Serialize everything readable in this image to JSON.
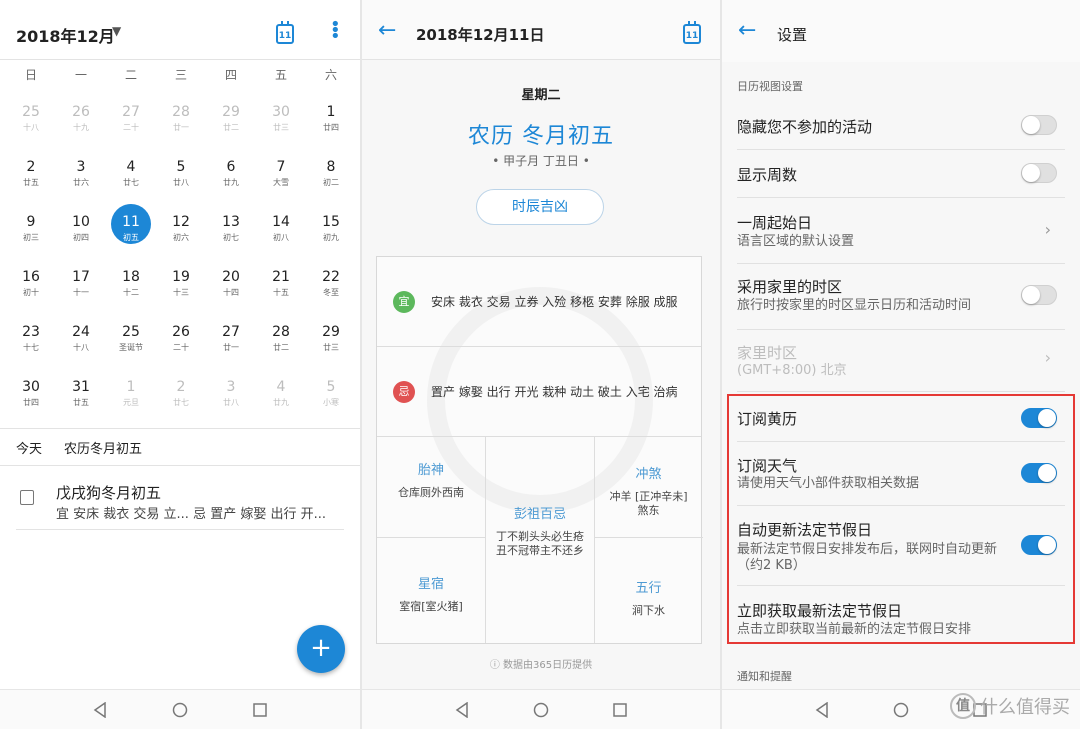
{
  "month_view": {
    "title": "2018年12月",
    "today_icon_num": "11",
    "weekdays": [
      "日",
      "一",
      "二",
      "三",
      "四",
      "五",
      "六"
    ],
    "weeks": [
      [
        {
          "n": "25",
          "l": "十八",
          "dim": true
        },
        {
          "n": "26",
          "l": "十九",
          "dim": true
        },
        {
          "n": "27",
          "l": "二十",
          "dim": true
        },
        {
          "n": "28",
          "l": "廿一",
          "dim": true
        },
        {
          "n": "29",
          "l": "廿二",
          "dim": true
        },
        {
          "n": "30",
          "l": "廿三",
          "dim": true
        },
        {
          "n": "1",
          "l": "廿四"
        }
      ],
      [
        {
          "n": "2",
          "l": "廿五"
        },
        {
          "n": "3",
          "l": "廿六"
        },
        {
          "n": "4",
          "l": "廿七"
        },
        {
          "n": "5",
          "l": "廿八"
        },
        {
          "n": "6",
          "l": "廿九"
        },
        {
          "n": "7",
          "l": "大雪"
        },
        {
          "n": "8",
          "l": "初二"
        }
      ],
      [
        {
          "n": "9",
          "l": "初三"
        },
        {
          "n": "10",
          "l": "初四"
        },
        {
          "n": "11",
          "l": "初五",
          "sel": true
        },
        {
          "n": "12",
          "l": "初六"
        },
        {
          "n": "13",
          "l": "初七"
        },
        {
          "n": "14",
          "l": "初八"
        },
        {
          "n": "15",
          "l": "初九"
        }
      ],
      [
        {
          "n": "16",
          "l": "初十"
        },
        {
          "n": "17",
          "l": "十一"
        },
        {
          "n": "18",
          "l": "十二"
        },
        {
          "n": "19",
          "l": "十三"
        },
        {
          "n": "20",
          "l": "十四"
        },
        {
          "n": "21",
          "l": "十五"
        },
        {
          "n": "22",
          "l": "冬至"
        }
      ],
      [
        {
          "n": "23",
          "l": "十七"
        },
        {
          "n": "24",
          "l": "十八"
        },
        {
          "n": "25",
          "l": "圣诞节"
        },
        {
          "n": "26",
          "l": "二十"
        },
        {
          "n": "27",
          "l": "廿一"
        },
        {
          "n": "28",
          "l": "廿二"
        },
        {
          "n": "29",
          "l": "廿三"
        }
      ],
      [
        {
          "n": "30",
          "l": "廿四"
        },
        {
          "n": "31",
          "l": "廿五"
        },
        {
          "n": "1",
          "l": "元旦",
          "dim": true
        },
        {
          "n": "2",
          "l": "廿七",
          "dim": true
        },
        {
          "n": "3",
          "l": "廿八",
          "dim": true
        },
        {
          "n": "4",
          "l": "廿九",
          "dim": true
        },
        {
          "n": "5",
          "l": "小寒",
          "dim": true
        }
      ]
    ],
    "today_label": "今天",
    "today_lunar": "农历冬月初五",
    "event_title": "戊戌狗冬月初五",
    "event_sub": "宜 安床 裁衣 交易 立...   忌 置产 嫁娶 出行 开...",
    "fab": "+"
  },
  "day_view": {
    "title": "2018年12月11日",
    "today_icon_num": "11",
    "weekday": "星期二",
    "lunar": "农历 冬月初五",
    "ganzhi": "• 甲子月 丁丑日 •",
    "shichen": "时辰吉凶",
    "yi_badge": "宜",
    "yi": "安床 裁衣 交易 立券 入殓 移柩 安葬 除服 成服",
    "ji_badge": "忌",
    "ji": "置产 嫁娶 出行 开光 栽种 动土 破土 入宅 治病",
    "taishen_h": "胎神",
    "taishen_v": "仓库厕外西南",
    "pengzu_h": "彭祖百忌",
    "pengzu_v": "丁不剃头头必生疮 丑不冠带主不还乡",
    "chongsha_h": "冲煞",
    "chongsha_v": "冲羊 [正冲辛未] 煞东",
    "xingxiu_h": "星宿",
    "xingxiu_v": "室宿[室火猪]",
    "wuxing_h": "五行",
    "wuxing_v": "涧下水",
    "provider": "ⓘ  数据由365日历提供"
  },
  "settings": {
    "title": "设置",
    "section1": "日历视图设置",
    "hide": "隐藏您不参加的活动",
    "weeknum": "显示周数",
    "weekstart": "一周起始日",
    "weekstart_sub": "语言区域的默认设置",
    "hometz": "采用家里的时区",
    "hometz_sub": "旅行时按家里的时区显示日历和活动时间",
    "home": "家里时区",
    "home_sub": "(GMT+8:00) 北京",
    "almanac": "订阅黄历",
    "weather": "订阅天气",
    "weather_sub": "请使用天气小部件获取相关数据",
    "holiday": "自动更新法定节假日",
    "holiday_sub": "最新法定节假日安排发布后，联网时自动更新（约2 KB）",
    "fetch": "立即获取最新法定节假日",
    "fetch_sub": "点击立即获取当前最新的法定节假日安排",
    "section2": "通知和提醒",
    "watermark": "什么值得买",
    "watermark_badge": "值"
  },
  "colors": {
    "accent": "#1d87d6",
    "yi": "#5cb85c",
    "ji": "#e05252",
    "highlight": "#e53935"
  }
}
